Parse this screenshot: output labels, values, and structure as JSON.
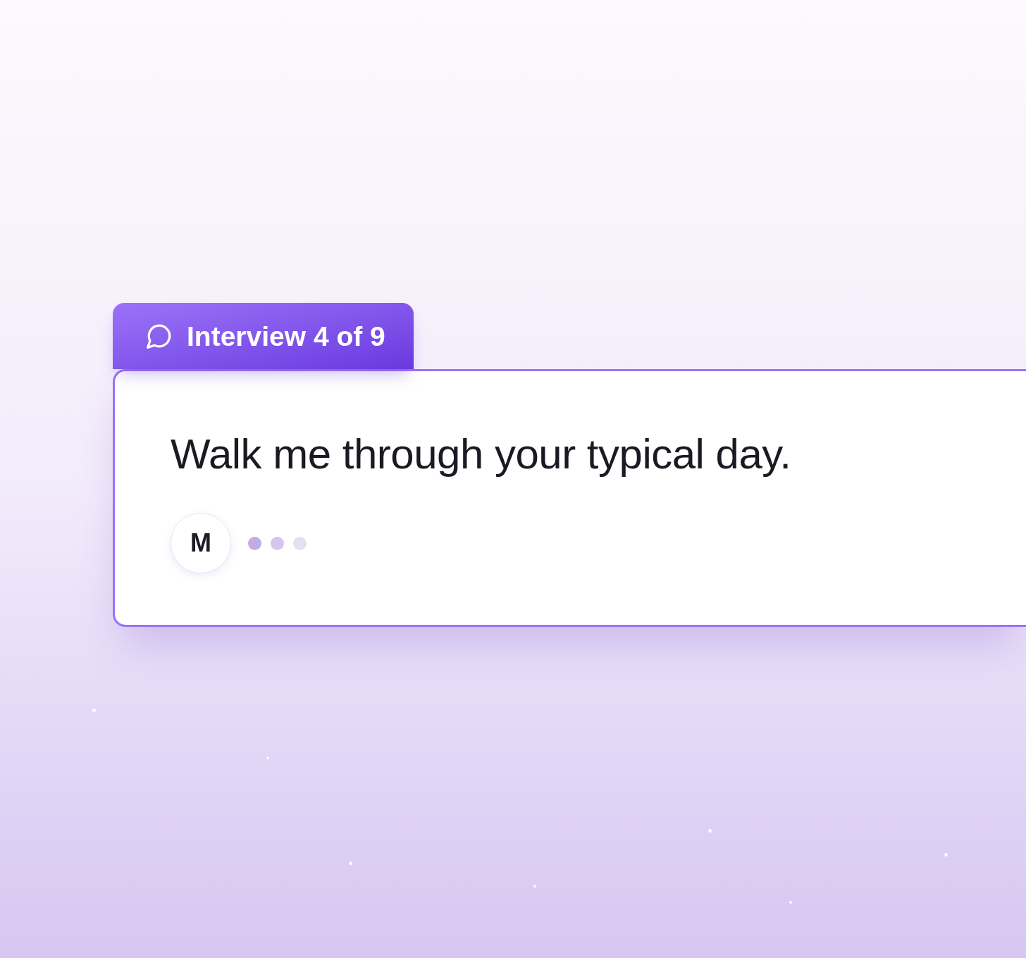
{
  "tab": {
    "label": "Interview 4 of 9"
  },
  "card": {
    "question": "Walk me through your typical day.",
    "avatar": {
      "initial": "M"
    },
    "typing_indicator": true
  }
}
